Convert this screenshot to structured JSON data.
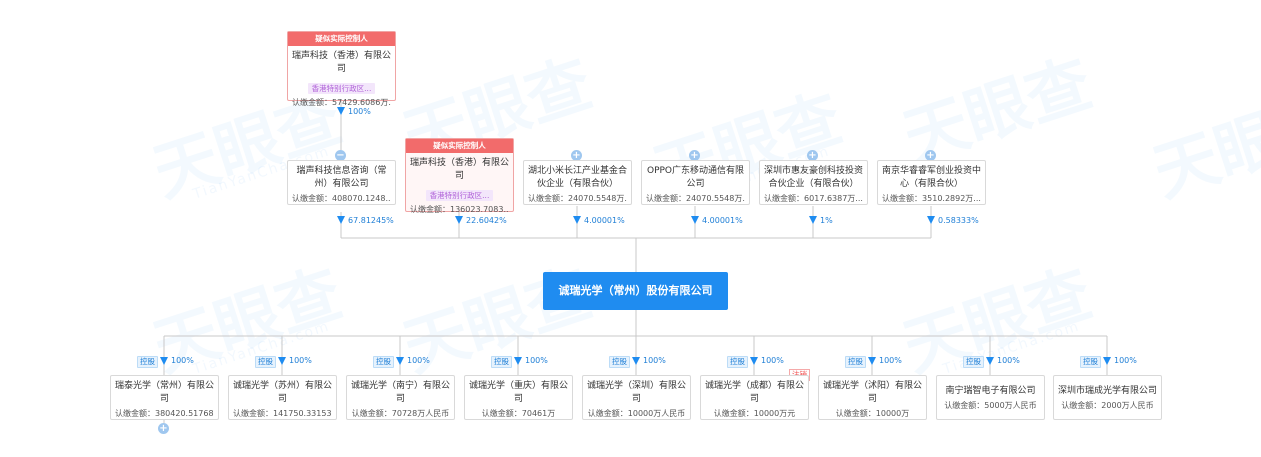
{
  "controller_tag": "疑似实际控制人",
  "control_tag": "控股",
  "cancel_tag": "注销",
  "center_company": "诚瑞光学（常州）股份有限公司",
  "icons": {
    "collapse": "−",
    "expand": "+"
  },
  "top_parent": {
    "name": "瑞声科技（香港）有限公司",
    "region": "香港特别行政区...",
    "amount": "认缴金额：57429.6086万...",
    "pct": "100%"
  },
  "shareholders": [
    {
      "name": "瑞声科技信息咨询（常州）有限公司",
      "amount": "认缴金额：408070.1248...",
      "pct": "67.81245%"
    },
    {
      "name": "瑞声科技（香港）有限公司",
      "region": "香港特别行政区...",
      "amount": "认缴金额：136023.7083...",
      "pct": "22.6042%"
    },
    {
      "name": "湖北小米长江产业基金合伙企业（有限合伙）",
      "amount": "认缴金额：24070.5548万...",
      "pct": "4.00001%"
    },
    {
      "name": "OPPO广东移动通信有限公司",
      "amount": "认缴金额：24070.5548万...",
      "pct": "4.00001%"
    },
    {
      "name": "深圳市惠友豪创科技投资合伙企业（有限合伙）",
      "amount": "认缴金额：6017.6387万...",
      "pct": "1%"
    },
    {
      "name": "南京华睿睿军创业投资中心（有限合伙）",
      "amount": "认缴金额：3510.2892万...",
      "pct": "0.58333%"
    }
  ],
  "subsidiaries": [
    {
      "name": "瑞泰光学（常州）有限公司",
      "amount": "认缴金额：380420.51768...",
      "pct": "100%"
    },
    {
      "name": "诚瑞光学（苏州）有限公司",
      "amount": "认缴金额：141750.33153...",
      "pct": "100%"
    },
    {
      "name": "诚瑞光学（南宁）有限公司",
      "amount": "认缴金额：70728万人民币",
      "pct": "100%"
    },
    {
      "name": "诚瑞光学（重庆）有限公司",
      "amount": "认缴金额：70461万",
      "pct": "100%"
    },
    {
      "name": "诚瑞光学（深圳）有限公司",
      "amount": "认缴金额：10000万人民币",
      "pct": "100%"
    },
    {
      "name": "诚瑞光学（成都）有限公司",
      "amount": "认缴金额：10000万元",
      "pct": "100%"
    },
    {
      "name": "诚瑞光学（沭阳）有限公司",
      "amount": "认缴金额：10000万",
      "pct": "100%"
    },
    {
      "name": "南宁瑞智电子有限公司",
      "amount": "认缴金额：5000万人民币",
      "pct": "100%"
    },
    {
      "name": "深圳市瑞成光学有限公司",
      "amount": "认缴金额：2000万人民币",
      "pct": "100%"
    }
  ],
  "watermark": {
    "brand": "天眼查",
    "sub": "TianYanCha.com"
  }
}
